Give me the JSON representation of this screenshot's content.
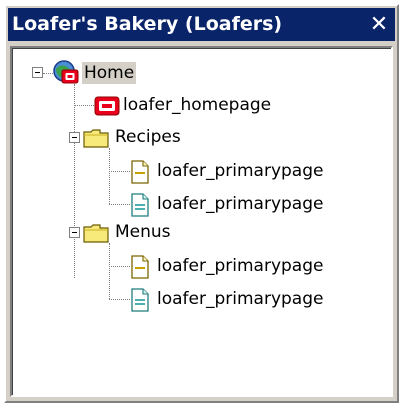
{
  "window": {
    "title": "Loafer's Bakery (Loafers)",
    "close_glyph": "✕"
  },
  "tree": {
    "root": {
      "label": "Home",
      "icon": "home-globe-icon"
    },
    "homepage": {
      "label": "loafer_homepage",
      "icon": "homepage-icon"
    },
    "recipes": {
      "label": "Recipes",
      "icon": "folder-icon",
      "children": [
        {
          "label": "loafer_primarypage",
          "icon": "page-yellow-icon"
        },
        {
          "label": "loafer_primarypage",
          "icon": "page-teal-icon"
        }
      ]
    },
    "menus": {
      "label": "Menus",
      "icon": "folder-icon",
      "children": [
        {
          "label": "loafer_primarypage",
          "icon": "page-yellow-icon"
        },
        {
          "label": "loafer_primarypage",
          "icon": "page-teal-icon"
        }
      ]
    }
  },
  "colors": {
    "titlebar": "#0a246a",
    "panel": "#d4d0c8",
    "folder": "#f7e97a",
    "homepage": "#e8001c",
    "page_yellow": "#c8a000",
    "page_teal": "#1f9c9c"
  }
}
